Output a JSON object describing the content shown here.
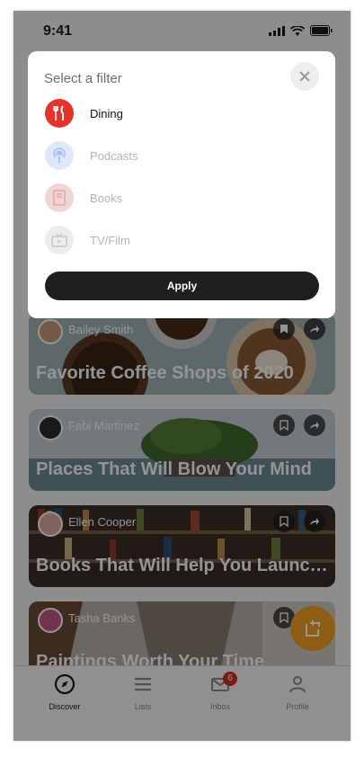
{
  "status_bar": {
    "time": "9:41"
  },
  "filter": {
    "title": "Select a filter",
    "options": [
      {
        "label": "Dining",
        "icon": "fork-knife-icon",
        "selected": true,
        "color": "#e5332a"
      },
      {
        "label": "Podcasts",
        "icon": "podcast-icon",
        "selected": false,
        "color": "#b9cdf7"
      },
      {
        "label": "Books",
        "icon": "book-icon",
        "selected": false,
        "color": "#e8b8b8"
      },
      {
        "label": "TV/Film",
        "icon": "tv-icon",
        "selected": false,
        "color": "#d9d9d9"
      }
    ],
    "apply_label": "Apply"
  },
  "feed": [
    {
      "author": "Bailey Smith",
      "title": "Favorite Coffee Shops of 2020"
    },
    {
      "author": "Fabi Martinez",
      "title": "Places That Will Blow Your Mind"
    },
    {
      "author": "Ellen Cooper",
      "title": "Books That Will Help You Launch Y..."
    },
    {
      "author": "Tasha Banks",
      "title": "Paintings Worth Your Time"
    }
  ],
  "tabbar": {
    "tabs": [
      {
        "label": "Discover",
        "icon": "compass-icon",
        "active": true
      },
      {
        "label": "Lists",
        "icon": "list-icon",
        "active": false
      },
      {
        "label": "Inbox",
        "icon": "mail-icon",
        "active": false,
        "badge": "6"
      },
      {
        "label": "Profile",
        "icon": "person-icon",
        "active": false
      }
    ]
  },
  "colors": {
    "accent": "#f2a021",
    "dark": "#1f1f22",
    "badge": "#d12b2b"
  }
}
